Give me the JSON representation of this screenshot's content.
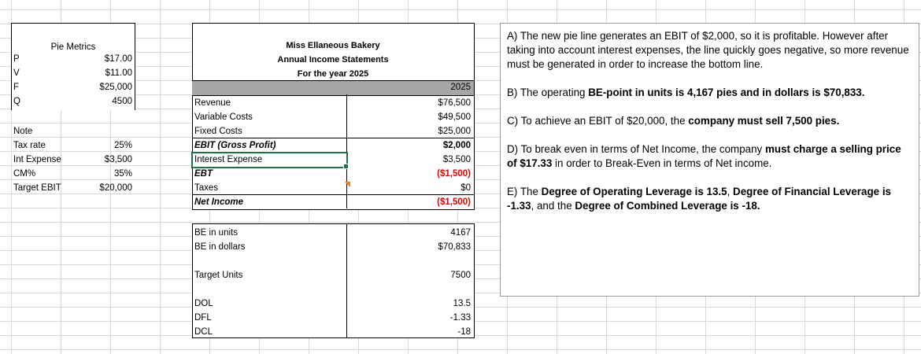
{
  "pie_metrics": {
    "header": "Pie Metrics",
    "rows": [
      {
        "label": "P",
        "value": "$17.00"
      },
      {
        "label": "V",
        "value": "$11.00"
      },
      {
        "label": "F",
        "value": "$25,000"
      },
      {
        "label": "Q",
        "value": "4500"
      }
    ]
  },
  "notes": {
    "header": "Note",
    "rows": [
      {
        "label": "Tax rate",
        "value": "25%"
      },
      {
        "label": "Int Expense",
        "value": "$3,500"
      },
      {
        "label": "CM%",
        "value": "35%"
      },
      {
        "label": "Target EBIT",
        "value": "$20,000"
      }
    ]
  },
  "income_statement": {
    "company": "Miss Ellaneous Bakery",
    "title": "Annual Income Statements",
    "period": "For the year 2025",
    "year_col": "2025",
    "rows": [
      {
        "label": "Revenue",
        "value": "$76,500"
      },
      {
        "label": "Variable Costs",
        "value": "$49,500"
      },
      {
        "label": "Fixed Costs",
        "value": "$25,000"
      },
      {
        "label": "EBIT (Gross Profit)",
        "value": "$2,000"
      },
      {
        "label": "Interest Expense",
        "value": "$3,500"
      },
      {
        "label": "EBT",
        "value": "($1,500)"
      },
      {
        "label": "Taxes",
        "value": "$0"
      },
      {
        "label": "Net Income",
        "value": "($1,500)"
      }
    ],
    "breakeven": [
      {
        "label": "BE in units",
        "value": "4167"
      },
      {
        "label": "BE in dollars",
        "value": "$70,833"
      }
    ],
    "target": {
      "label": "Target Units",
      "value": "7500"
    },
    "leverage": [
      {
        "label": "DOL",
        "value": "13.5"
      },
      {
        "label": "DFL",
        "value": "-1.33"
      },
      {
        "label": "DCL",
        "value": "-18"
      }
    ]
  },
  "answers": {
    "a": "A) The new pie line generates an EBIT of $2,000, so it is profitable. However after taking into account interest expenses, the line quickly goes negative, so more revenue must be generated in order to increase the bottom  line.",
    "b_pre": "B) The operating ",
    "b_bold": "BE-point in units is 4,167 pies and in dollars is $70,833.",
    "c_pre": "C) To achieve an EBIT of $20,000, the ",
    "c_bold": "company must sell 7,500 pies.",
    "d_pre": "D)  To break even in terms of Net Income, the company ",
    "d_bold1": "must charge a selling price of  $17.33",
    "d_post": " in order to Break-Even in terms of Net income.",
    "e_pre": "E) The ",
    "e_bold1": "Degree of Operating Leverage is 13.5",
    "e_mid1": ", ",
    "e_bold2": "Degree of Financial Leverage is -1.33",
    "e_mid2": ", and the ",
    "e_bold3": "Degree of Combined Leverage is -18."
  }
}
